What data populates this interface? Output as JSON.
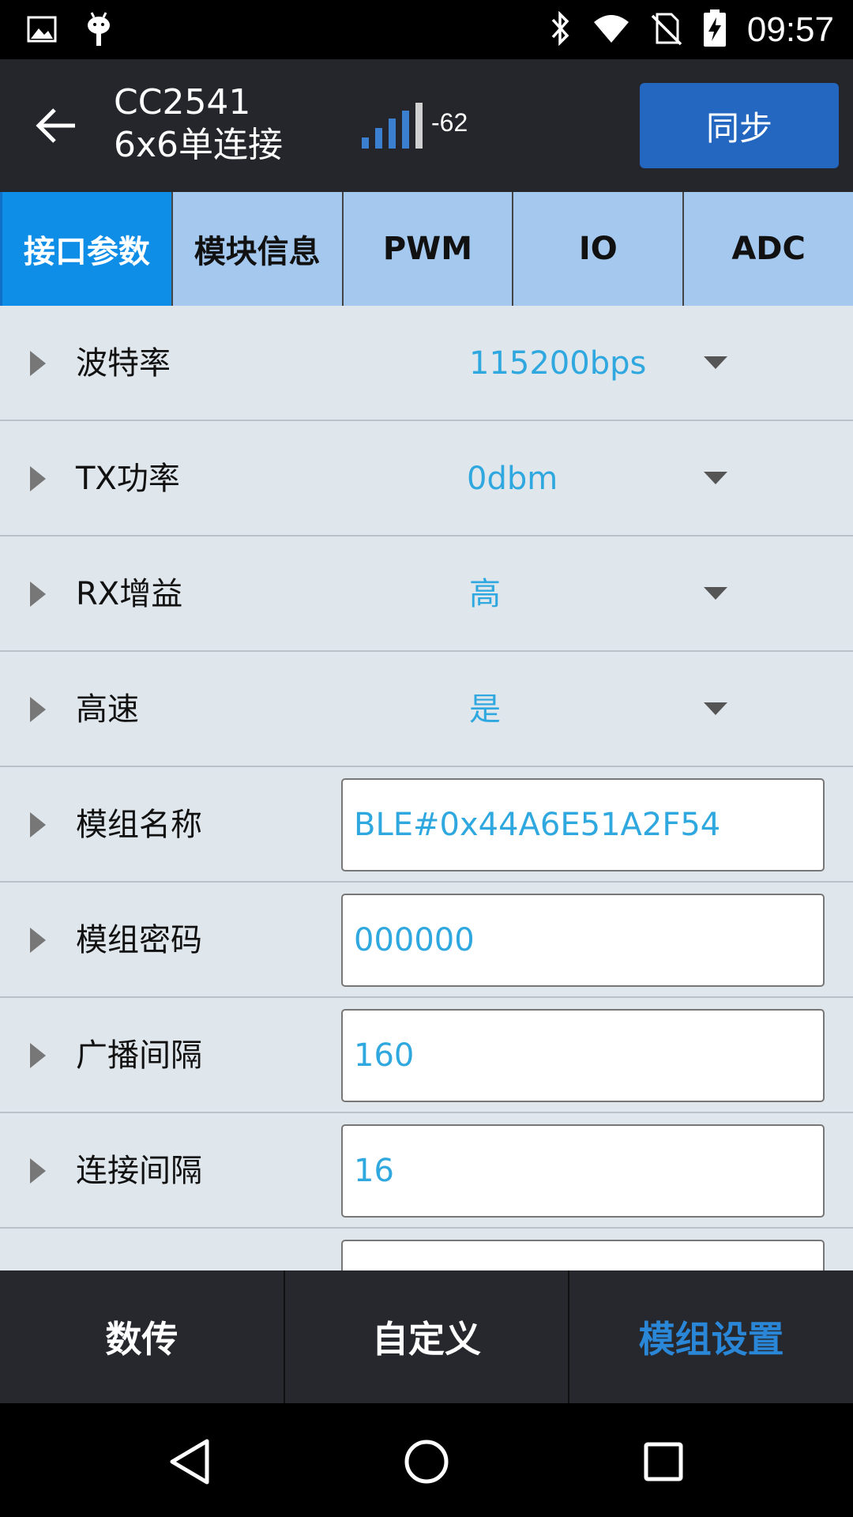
{
  "status_bar": {
    "time": "09:57",
    "icons": [
      "image-icon",
      "android-debug-icon",
      "bluetooth-icon",
      "wifi-icon",
      "no-sim-icon",
      "battery-charging-icon"
    ]
  },
  "app_bar": {
    "title_line1": "CC2541",
    "title_line2": "6x6单连接",
    "rssi": "-62",
    "signal_level": 4,
    "sync_label": "同步"
  },
  "tabs": [
    {
      "label": "接口参数",
      "active": true
    },
    {
      "label": "模块信息",
      "active": false
    },
    {
      "label": "PWM",
      "active": false
    },
    {
      "label": "IO",
      "active": false
    },
    {
      "label": "ADC",
      "active": false
    }
  ],
  "rows": [
    {
      "label": "波特率",
      "value": "115200bps",
      "kind": "dropdown"
    },
    {
      "label": "TX功率",
      "value": "0dbm",
      "kind": "dropdown"
    },
    {
      "label": "RX增益",
      "value": "高",
      "kind": "dropdown"
    },
    {
      "label": "高速",
      "value": "是",
      "kind": "dropdown"
    },
    {
      "label": "模组名称",
      "value": "BLE#0x44A6E51A2F54",
      "kind": "input"
    },
    {
      "label": "模组密码",
      "value": "000000",
      "kind": "input"
    },
    {
      "label": "广播间隔",
      "value": "160",
      "kind": "input"
    },
    {
      "label": "连接间隔",
      "value": "16",
      "kind": "input"
    },
    {
      "label": "",
      "value": "",
      "kind": "input"
    }
  ],
  "bottom_nav": [
    {
      "label": "数传",
      "active": false
    },
    {
      "label": "自定义",
      "active": false
    },
    {
      "label": "模组设置",
      "active": true
    }
  ],
  "colors": {
    "accent_blue": "#2367c0",
    "value_blue": "#2fa7df",
    "tab_active": "#0f8ee8",
    "tab_inactive": "#a5c8ef",
    "list_bg": "#dfe6ec",
    "appbar_bg": "#24262b"
  }
}
